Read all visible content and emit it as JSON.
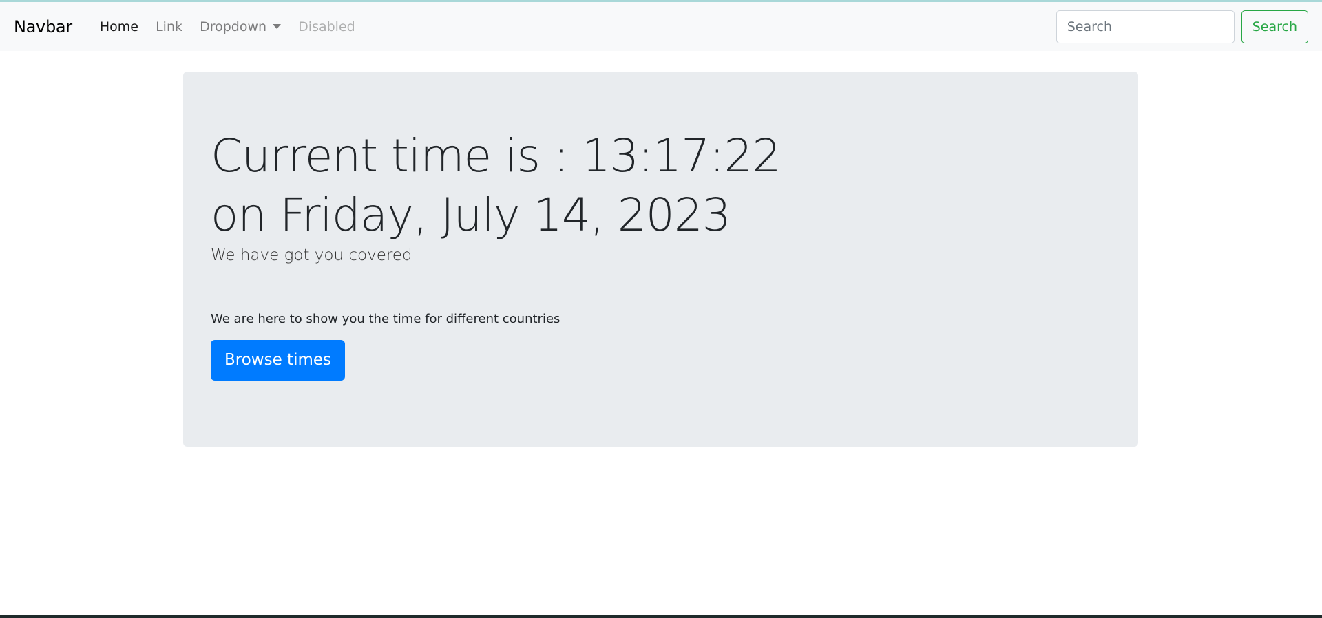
{
  "navbar": {
    "brand": "Navbar",
    "items": [
      {
        "label": "Home"
      },
      {
        "label": "Link"
      },
      {
        "label": "Dropdown"
      },
      {
        "label": "Disabled"
      }
    ],
    "search_placeholder": "Search",
    "search_button": "Search"
  },
  "jumbotron": {
    "line1": "Current time is : 13:17:22",
    "line2": "on Friday, July 14, 2023",
    "lead": "We have got you covered",
    "text": "We are here to show you the time for different countries",
    "button": "Browse times"
  }
}
